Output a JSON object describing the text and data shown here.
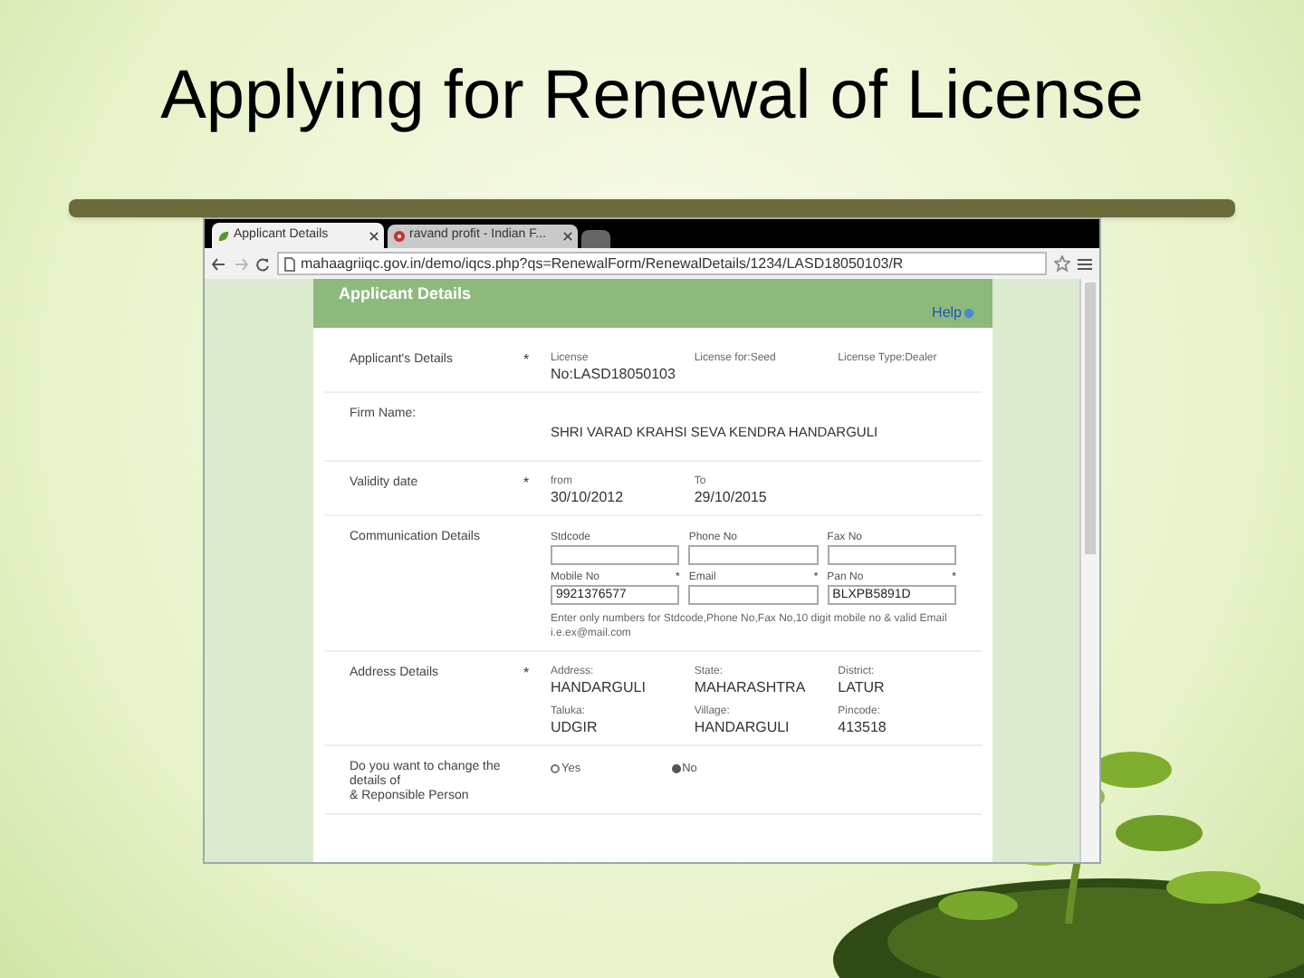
{
  "slide": {
    "title": "Applying for Renewal of License"
  },
  "browser": {
    "tabs": [
      {
        "label": "Applicant Details",
        "selected": true
      },
      {
        "label": "ravand profit - Indian F...",
        "selected": false
      }
    ],
    "url": "mahaagriiqc.gov.in/demo/iqcs.php?qs=RenewalForm/RenewalDetails/1234/LASD18050103/R"
  },
  "page": {
    "header": "Applicant Details",
    "help": "Help",
    "rows": [
      {
        "kind": "fields",
        "label": [
          "Applicant's Details"
        ],
        "mark": "*",
        "fields": [
          {
            "label": "License",
            "value": "No:LASD18050103"
          },
          {
            "label": "License for:Seed"
          },
          {
            "label": "License Type:Dealer"
          }
        ]
      },
      {
        "kind": "text",
        "label": [
          "Firm Name:"
        ],
        "value": "SHRI VARAD KRAHSI SEVA KENDRA HANDARGULI"
      },
      {
        "kind": "fields",
        "label": [
          "Validity date"
        ],
        "mark": "*",
        "fields": [
          {
            "label": "from",
            "value": "30/10/2012"
          },
          {
            "label": "To",
            "value": "29/10/2015"
          }
        ]
      },
      {
        "kind": "inputs",
        "label": [
          "Communication Details"
        ],
        "inputs": [
          {
            "label": "Stdcode"
          },
          {
            "label": "Phone No"
          },
          {
            "label": "Fax No"
          },
          {
            "label": "Mobile No",
            "mark": "*",
            "value": "9921376577"
          },
          {
            "label": "Email",
            "mark": "*"
          },
          {
            "label": "Pan No",
            "mark": "*",
            "value": "BLXPB5891D"
          }
        ],
        "note": "Enter only numbers for Stdcode,Phone No,Fax No,10 digit mobile no & valid Email i.e.ex@mail.com"
      },
      {
        "kind": "fields",
        "label": [
          "Address Details"
        ],
        "mark": "*",
        "fields": [
          {
            "label": "Address:",
            "value": "HANDARGULI"
          },
          {
            "label": "State:",
            "value": "MAHARASHTRA"
          },
          {
            "label": "District:",
            "value": "LATUR"
          },
          {
            "label": "Taluka:",
            "value": "UDGIR"
          },
          {
            "label": "Village:",
            "value": "HANDARGULI"
          },
          {
            "label": "Pincode:",
            "value": "413518"
          }
        ]
      },
      {
        "kind": "radio",
        "label": [
          "Do you want to change the",
          "details of",
          "& Reponsible Person"
        ],
        "options": [
          {
            "label": "Yes",
            "selected": false
          },
          {
            "label": "No",
            "selected": true
          }
        ]
      }
    ]
  }
}
